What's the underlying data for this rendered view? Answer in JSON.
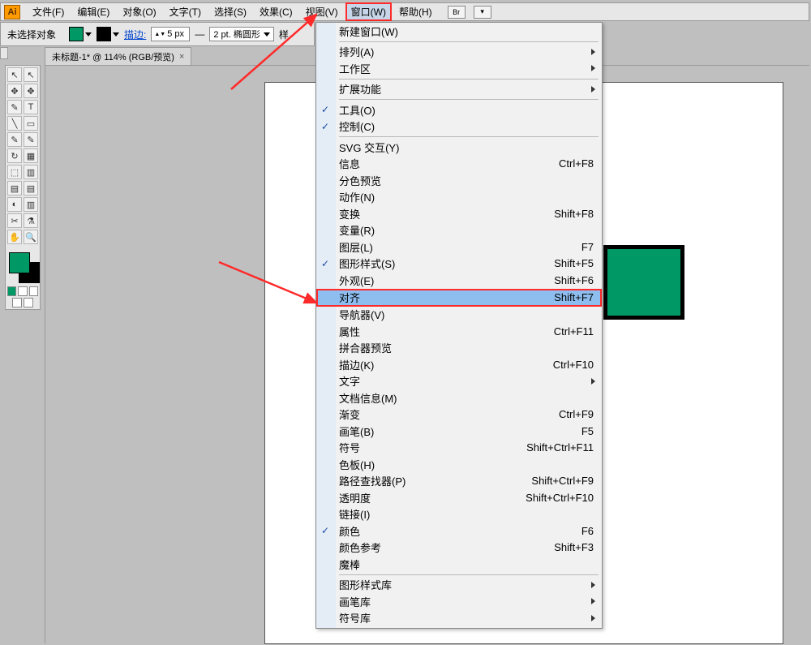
{
  "app_logo": "Ai",
  "menubar": {
    "items": [
      "文件(F)",
      "编辑(E)",
      "对象(O)",
      "文字(T)",
      "选择(S)",
      "效果(C)",
      "视图(V)",
      "窗口(W)",
      "帮助(H)"
    ],
    "active_index": 7,
    "extra_buttons": [
      "Br",
      "▾"
    ]
  },
  "controlbar": {
    "selection_status": "未选择对象",
    "stroke_label": "描边:",
    "stroke_value": "5 px",
    "brush_label": "2 pt. 椭圆形",
    "style_label": "样"
  },
  "doc_tab": {
    "title": "未标题-1* @ 114% (RGB/预览)"
  },
  "dropdown": {
    "groups": [
      [
        {
          "label": "新建窗口(W)",
          "checked": false,
          "arrow": false
        }
      ],
      [
        {
          "label": "排列(A)",
          "checked": false,
          "arrow": true
        },
        {
          "label": "工作区",
          "checked": false,
          "arrow": true
        }
      ],
      [
        {
          "label": "扩展功能",
          "checked": false,
          "arrow": true
        }
      ],
      [
        {
          "label": "工具(O)",
          "checked": true,
          "arrow": false
        },
        {
          "label": "控制(C)",
          "checked": true,
          "arrow": false
        }
      ],
      [
        {
          "label": "SVG 交互(Y)",
          "checked": false,
          "arrow": false
        },
        {
          "label": "信息",
          "shortcut": "Ctrl+F8",
          "checked": false,
          "arrow": false
        },
        {
          "label": "分色预览",
          "checked": false,
          "arrow": false
        },
        {
          "label": "动作(N)",
          "checked": false,
          "arrow": false
        },
        {
          "label": "变换",
          "shortcut": "Shift+F8",
          "checked": false,
          "arrow": false
        },
        {
          "label": "变量(R)",
          "checked": false,
          "arrow": false
        },
        {
          "label": "图层(L)",
          "shortcut": "F7",
          "checked": false,
          "arrow": false
        },
        {
          "label": "图形样式(S)",
          "shortcut": "Shift+F5",
          "checked": true,
          "arrow": false
        },
        {
          "label": "外观(E)",
          "shortcut": "Shift+F6",
          "checked": false,
          "arrow": false
        },
        {
          "label": "对齐",
          "shortcut": "Shift+F7",
          "checked": false,
          "arrow": false,
          "highlight": true
        },
        {
          "label": "导航器(V)",
          "checked": false,
          "arrow": false
        },
        {
          "label": "属性",
          "shortcut": "Ctrl+F11",
          "checked": false,
          "arrow": false
        },
        {
          "label": "拼合器预览",
          "checked": false,
          "arrow": false
        },
        {
          "label": "描边(K)",
          "shortcut": "Ctrl+F10",
          "checked": false,
          "arrow": false
        },
        {
          "label": "文字",
          "checked": false,
          "arrow": true
        },
        {
          "label": "文档信息(M)",
          "checked": false,
          "arrow": false
        },
        {
          "label": "渐变",
          "shortcut": "Ctrl+F9",
          "checked": false,
          "arrow": false
        },
        {
          "label": "画笔(B)",
          "shortcut": "F5",
          "checked": false,
          "arrow": false
        },
        {
          "label": "符号",
          "shortcut": "Shift+Ctrl+F11",
          "checked": false,
          "arrow": false
        },
        {
          "label": "色板(H)",
          "checked": false,
          "arrow": false
        },
        {
          "label": "路径查找器(P)",
          "shortcut": "Shift+Ctrl+F9",
          "checked": false,
          "arrow": false
        },
        {
          "label": "透明度",
          "shortcut": "Shift+Ctrl+F10",
          "checked": false,
          "arrow": false
        },
        {
          "label": "链接(I)",
          "checked": false,
          "arrow": false
        },
        {
          "label": "颜色",
          "shortcut": "F6",
          "checked": true,
          "arrow": false
        },
        {
          "label": "颜色参考",
          "shortcut": "Shift+F3",
          "checked": false,
          "arrow": false
        },
        {
          "label": "魔棒",
          "checked": false,
          "arrow": false
        }
      ],
      [
        {
          "label": "图形样式库",
          "checked": false,
          "arrow": true
        },
        {
          "label": "画笔库",
          "checked": false,
          "arrow": true
        },
        {
          "label": "符号库",
          "checked": false,
          "arrow": true
        }
      ]
    ]
  },
  "tools": [
    "↖",
    "↖",
    "✥",
    "✥",
    "✎",
    "T",
    "╲",
    "▭",
    "✎",
    "✎",
    "↻",
    "▦",
    "⬚",
    "▥",
    "▤",
    "▤",
    "◐",
    "▥",
    "✂",
    "⚗",
    "✋",
    "🔍"
  ],
  "colors": {
    "fill": "#009966",
    "stroke": "#000000",
    "accent_highlight": "#8ebef0",
    "annotation": "#ff2a2a"
  }
}
